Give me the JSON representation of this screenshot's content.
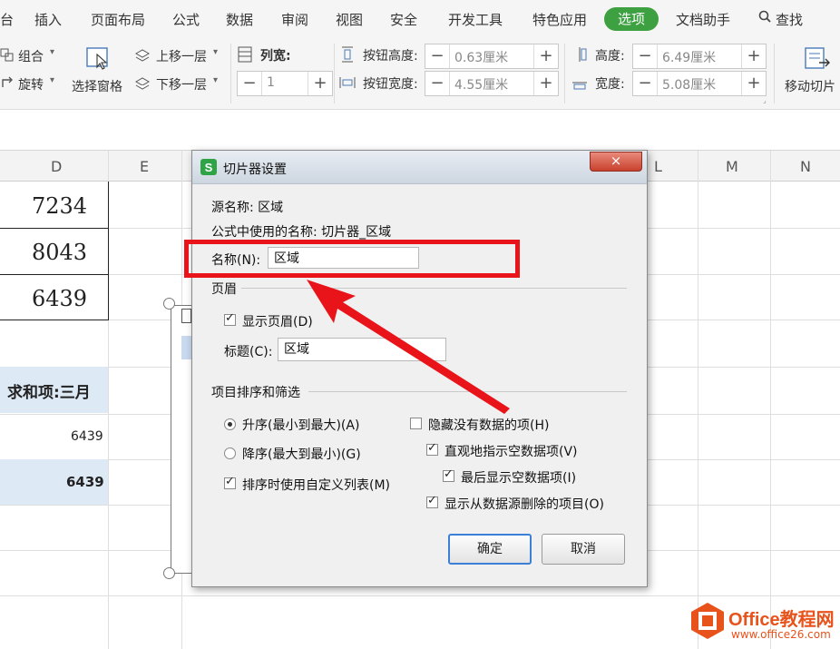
{
  "menu": {
    "items": [
      "台",
      "插入",
      "页面布局",
      "公式",
      "数据",
      "审阅",
      "视图",
      "安全",
      "开发工具",
      "特色应用"
    ],
    "active": "选项",
    "after": [
      "文档助手"
    ],
    "search": "查找"
  },
  "ribbon": {
    "group": "组合",
    "rotate": "旋转",
    "selection_pane": "选择窗格",
    "bring_forward": "上移一层",
    "send_backward": "下移一层",
    "col_width_label": "列宽:",
    "col_width_value": "1",
    "btn_height_label": "按钮高度:",
    "btn_height_value": "0.63厘米",
    "btn_width_label": "按钮宽度:",
    "btn_width_value": "4.55厘米",
    "height_label": "高度:",
    "height_value": "6.49厘米",
    "width_label": "宽度:",
    "width_value": "5.08厘米",
    "move_slicer": "移动切片"
  },
  "sheet": {
    "columns": [
      "D",
      "E",
      "L",
      "M",
      "N"
    ],
    "values": [
      "7234",
      "8043",
      "6439"
    ],
    "pivot_header": "求和项:三月",
    "pivot_value": "6439",
    "pivot_total": "6439"
  },
  "dialog": {
    "title": "切片器设置",
    "close": "×",
    "source_name": "源名称: 区域",
    "formula_name": "公式中使用的名称: 切片器_区域",
    "name_label": "名称(N):",
    "name_value": "区域",
    "header_group": "页眉",
    "show_header": "显示页眉(D)",
    "caption_label": "标题(C):",
    "caption_value": "区域",
    "sort_group": "项目排序和筛选",
    "ascending": "升序(最小到最大)(A)",
    "descending": "降序(最大到最小)(G)",
    "custom_list": "排序时使用自定义列表(M)",
    "hide_no_data": "隐藏没有数据的项(H)",
    "visual_indicate": "直观地指示空数据项(V)",
    "show_last": "最后显示空数据项(I)",
    "show_deleted": "显示从数据源删除的项目(O)",
    "ok": "确定",
    "cancel": "取消"
  },
  "watermark": {
    "brand": "Office教程网",
    "url": "www.office26.com"
  },
  "colors": {
    "accent": "#3da041",
    "highlight": "#e8141a",
    "watermark_orange": "#e8521b"
  }
}
